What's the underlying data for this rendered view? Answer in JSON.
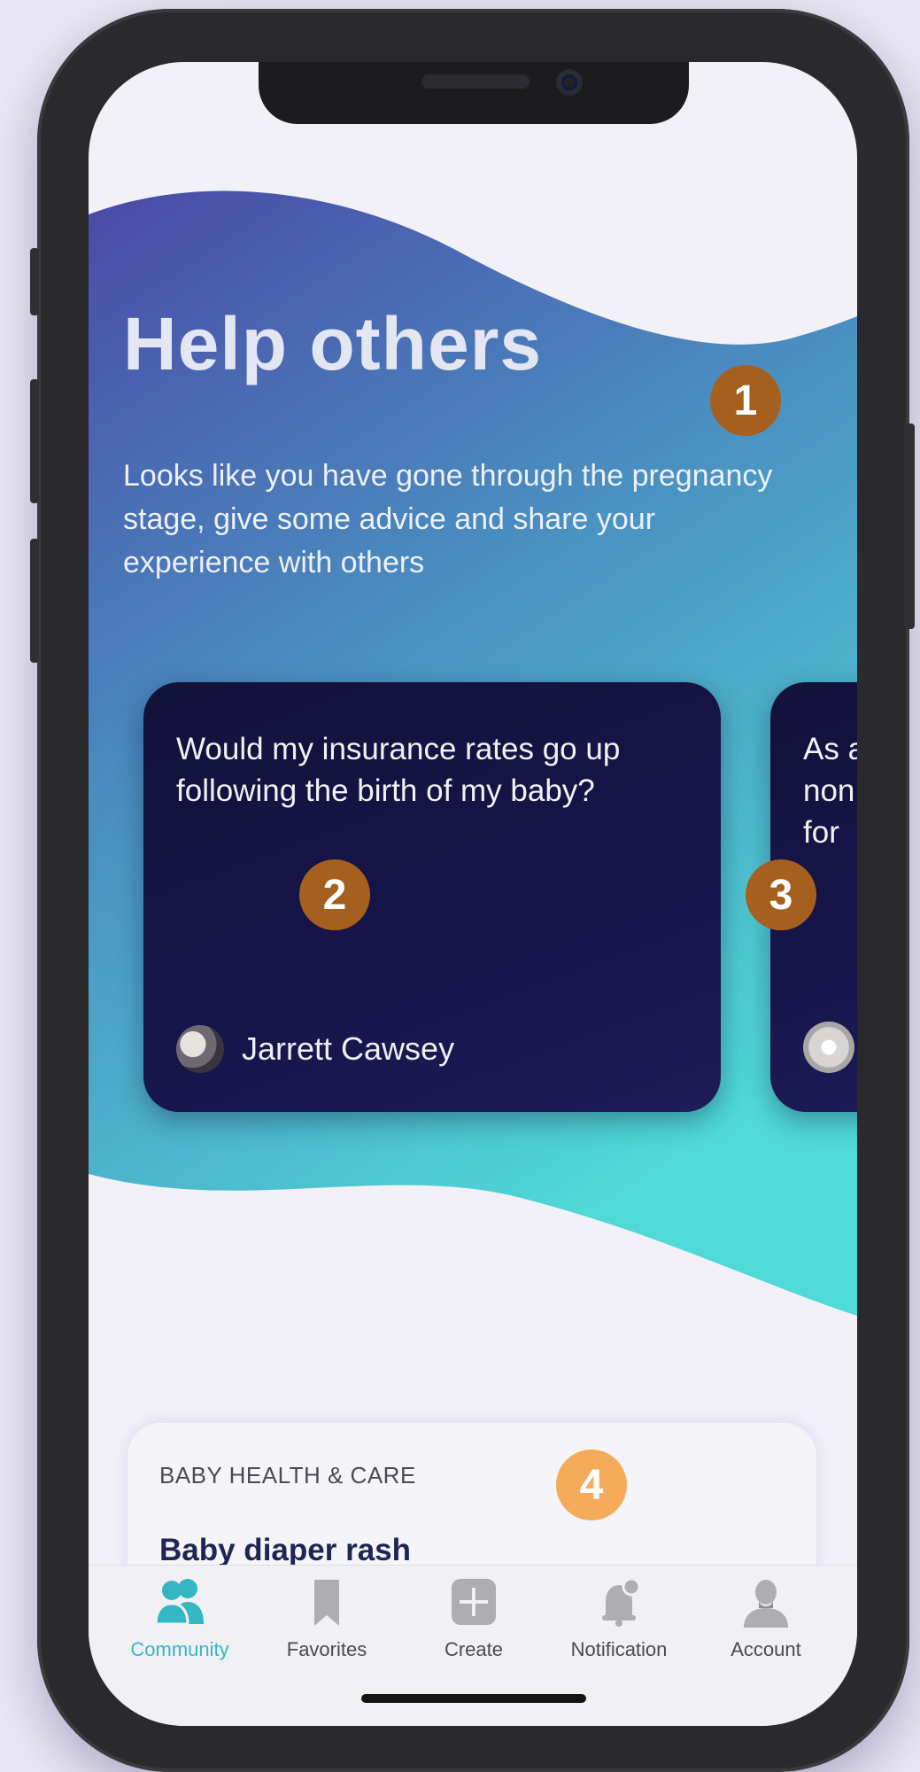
{
  "hero": {
    "title": "Help others",
    "description": "Looks like you have gone through the pregnancy stage, give some advice and share your experience with others"
  },
  "question_cards": [
    {
      "question": "Would my insurance rates go up following the birth of my baby?",
      "author": "Jarrett Cawsey"
    },
    {
      "question": "As a\nnon\nfor ",
      "author": ""
    }
  ],
  "topic_card": {
    "category": "BABY HEALTH & CARE",
    "title": "Baby diaper rash"
  },
  "annotations": {
    "badge_1": "1",
    "badge_2": "2",
    "badge_3": "3",
    "badge_4": "4",
    "colors": {
      "dark_orange": "#a5601f",
      "light_orange": "#f5ac5a"
    }
  },
  "tabbar": {
    "active": "Community",
    "items": [
      {
        "label": "Community",
        "icon": "community-icon"
      },
      {
        "label": "Favorites",
        "icon": "bookmark-icon"
      },
      {
        "label": "Create",
        "icon": "plus-square-icon"
      },
      {
        "label": "Notification",
        "icon": "bell-icon"
      },
      {
        "label": "Account",
        "icon": "account-icon"
      }
    ]
  },
  "colors": {
    "accent": "#35b6c4",
    "wave_start": "#4a4aa8",
    "wave_end": "#4fd8d6",
    "card_bg": "#14133c"
  }
}
